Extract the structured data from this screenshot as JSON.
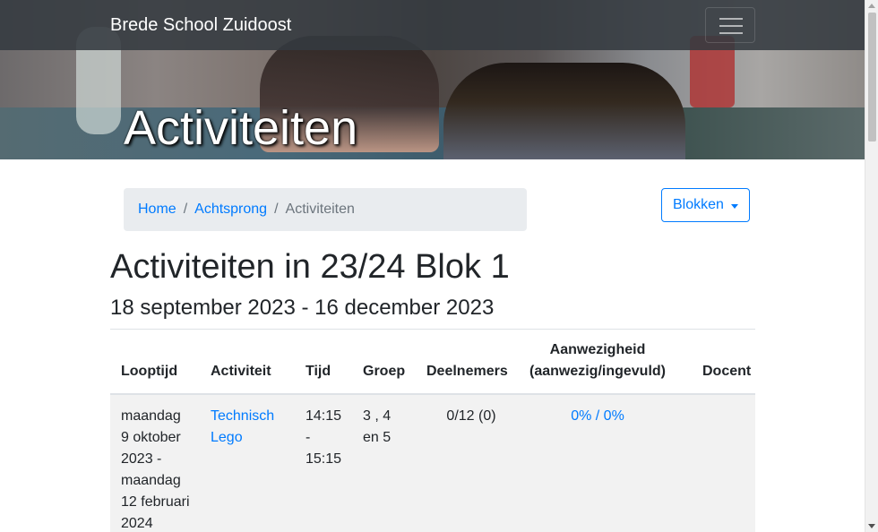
{
  "navbar": {
    "brand": "Brede School Zuidoost",
    "toggler_icon": "hamburger-icon"
  },
  "hero": {
    "title": "Activiteiten"
  },
  "breadcrumb": {
    "items": [
      {
        "label": "Home",
        "link": true
      },
      {
        "label": "Achtsprong",
        "link": true
      },
      {
        "label": "Activiteiten",
        "link": false
      }
    ],
    "separator": "/"
  },
  "dropdown": {
    "label": "Blokken",
    "icon": "caret-down-icon"
  },
  "heading": {
    "title": "Activiteiten in 23/24 Blok 1",
    "subtitle": "18 september 2023 - 16 december 2023"
  },
  "table": {
    "headers": {
      "looptijd": "Looptijd",
      "activiteit": "Activiteit",
      "tijd": "Tijd",
      "groep": "Groep",
      "deelnemers": "Deelnemers",
      "aanwezigheid_line1": "Aanwezigheid",
      "aanwezigheid_line2": "(aanwezig/ingevuld)",
      "docent": "Docent"
    },
    "rows": [
      {
        "looptijd": [
          "maandag",
          "9 oktober",
          "2023 -",
          "maandag",
          "12 februari",
          "2024"
        ],
        "activiteit": [
          "Technisch",
          "Lego"
        ],
        "tijd": [
          "14:15",
          "-",
          "15:15"
        ],
        "groep": [
          "3 , 4",
          "en 5"
        ],
        "deelnemers": "0/12 (0)",
        "aanwezigheid": "0% / 0%",
        "docent": ""
      }
    ]
  },
  "colors": {
    "link": "#007bff",
    "navbar_bg": "#343a40",
    "breadcrumb_bg": "#e9ecef",
    "row_stripe": "#f2f2f2"
  }
}
